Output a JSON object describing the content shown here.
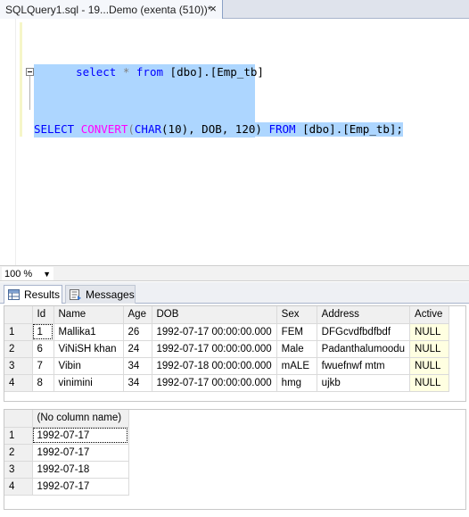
{
  "window": {
    "tab_title": "SQLQuery1.sql - 19...Demo (exenta (510))*",
    "close_glyph": "×"
  },
  "editor": {
    "line1": {
      "kw_select": "select",
      "star": "*",
      "kw_from": "from",
      "obj": "[dbo].[Emp_tb]"
    },
    "line2": {
      "kw_select": "SELECT",
      "fn_convert": "CONVERT",
      "paren_open": "(",
      "kw_char": "CHAR",
      "arg": "(10), DOB, 120)",
      "kw_from": "FROM",
      "obj": "[dbo].[Emp_tb];"
    }
  },
  "zoom": {
    "value": "100 %"
  },
  "result_tabs": [
    {
      "label": "Results",
      "icon": "grid-icon"
    },
    {
      "label": "Messages",
      "icon": "message-icon"
    }
  ],
  "grid1": {
    "columns": [
      "Id",
      "Name",
      "Age",
      "DOB",
      "Sex",
      "Address",
      "Active"
    ],
    "rows": [
      {
        "num": "1",
        "cells": [
          "1",
          "Mallika1",
          "26",
          "1992-07-17 00:00:00.000",
          "FEM",
          "DFGcvdfbdfbdf",
          "NULL"
        ]
      },
      {
        "num": "2",
        "cells": [
          "6",
          "ViNiSH khan",
          "24",
          "1992-07-17 00:00:00.000",
          "Male",
          "Padanthalumoodu",
          "NULL"
        ]
      },
      {
        "num": "3",
        "cells": [
          "7",
          "Vibin",
          "34",
          "1992-07-18 00:00:00.000",
          "mALE",
          "fwuefnwf mtm",
          "NULL"
        ]
      },
      {
        "num": "4",
        "cells": [
          "8",
          "vinimini",
          "34",
          "1992-07-17 00:00:00.000",
          "hmg",
          "ujkb",
          "NULL"
        ]
      }
    ]
  },
  "grid2": {
    "columns": [
      "(No column name)"
    ],
    "rows": [
      {
        "num": "1",
        "cells": [
          "1992-07-17"
        ]
      },
      {
        "num": "2",
        "cells": [
          "1992-07-17"
        ]
      },
      {
        "num": "3",
        "cells": [
          "1992-07-18"
        ]
      },
      {
        "num": "4",
        "cells": [
          "1992-07-17"
        ]
      }
    ]
  },
  "colors": {
    "selection": "#add6ff",
    "keyword": "#0000ff",
    "function": "#ff00ff",
    "null_cell": "#ffffe1"
  }
}
